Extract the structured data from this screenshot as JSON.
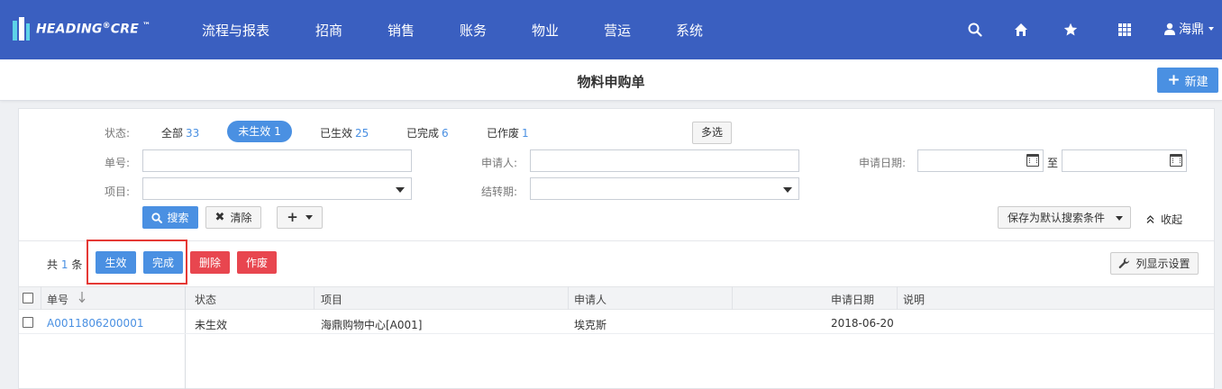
{
  "brand": {
    "name": "HEADING",
    "reg": "®",
    "suffix": "CRE",
    "tm": "™"
  },
  "nav": [
    "流程与报表",
    "招商",
    "销售",
    "账务",
    "物业",
    "营运",
    "系统"
  ],
  "user": {
    "name": "海鼎"
  },
  "page": {
    "title": "物料申购单",
    "new_label": "新建"
  },
  "filter": {
    "status_label": "状态:",
    "statuses": [
      {
        "label": "全部",
        "count": "33"
      },
      {
        "label": "未生效",
        "count": "1"
      },
      {
        "label": "已生效",
        "count": "25"
      },
      {
        "label": "已完成",
        "count": "6"
      },
      {
        "label": "已作废",
        "count": "1"
      }
    ],
    "multi_select": "多选",
    "number_label": "单号:",
    "applicant_label": "申请人:",
    "apply_date_label": "申请日期:",
    "date_to": "至",
    "project_label": "项目:",
    "period_label": "结转期:",
    "search": "搜索",
    "clear": "清除",
    "save_default": "保存为默认搜索条件",
    "collapse": "收起"
  },
  "actions": {
    "total_prefix": "共",
    "total_count": "1",
    "total_suffix": "条",
    "effective": "生效",
    "complete": "完成",
    "delete": "删除",
    "void": "作废",
    "column_settings": "列显示设置"
  },
  "table": {
    "headers": {
      "number": "单号",
      "status": "状态",
      "project": "项目",
      "applicant": "申请人",
      "apply_date": "申请日期",
      "remark": "说明"
    },
    "rows": [
      {
        "number": "A0011806200001",
        "status": "未生效",
        "project": "海鼎购物中心[A001]",
        "applicant": "埃克斯",
        "apply_date": "2018-06-20",
        "remark": ""
      }
    ]
  },
  "colors": {
    "nav_bg": "#3a5fc0",
    "primary": "#4a90e2",
    "danger": "#e8464f",
    "highlight_box": "#e53935"
  }
}
